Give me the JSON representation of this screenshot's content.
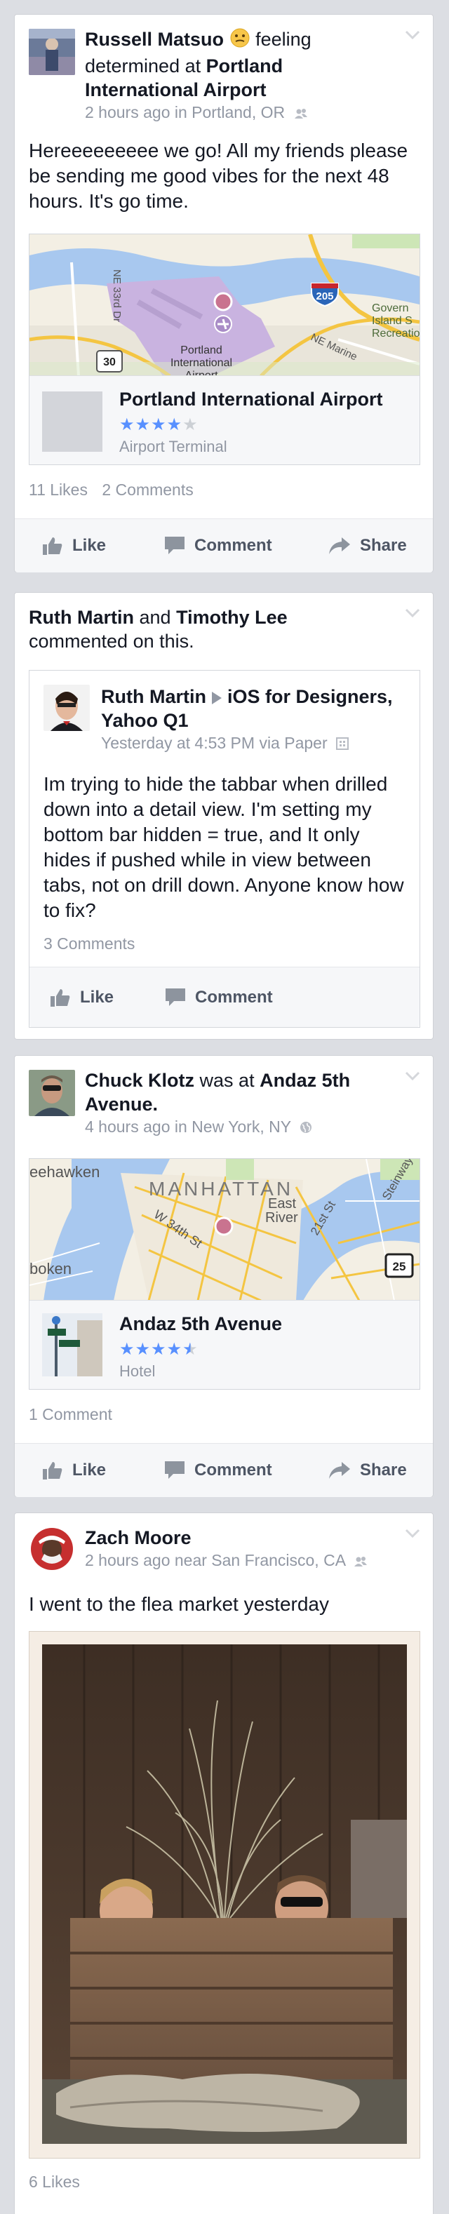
{
  "posts": [
    {
      "author": "Russell Matsuo",
      "verb": "feeling determined at",
      "location": "Portland International Airport",
      "time": "2 hours ago in Portland, OR",
      "text": "Hereeeeeeeee we go! All my friends please be sending me good vibes for the next 48 hours. It's go time.",
      "map_labels": {
        "highway1": "205",
        "highway2": "30",
        "dr": "NE 33rd Dr",
        "marine": "NE Marine",
        "govt": "Govern Island S Recreatio",
        "airport": "Portland International Airport"
      },
      "place": {
        "name": "Portland International Airport",
        "category": "Airport Terminal",
        "stars": 4
      },
      "likes": "11 Likes",
      "comments": "2 Comments",
      "actions": {
        "like": "Like",
        "comment": "Comment",
        "share": "Share"
      }
    },
    {
      "actor1": "Ruth Martin",
      "and": "and",
      "actor2": "Timothy Lee",
      "commented": "commented on this.",
      "inner_author": "Ruth Martin",
      "inner_group": "iOS for Designers, Yahoo Q1",
      "inner_time": "Yesterday at 4:53 PM via Paper",
      "text": "Im trying to hide the tabbar when drilled down into a detail view. I'm setting my bottom bar hidden = true, and It only hides if pushed while in view between tabs, not on drill down.  Anyone know how to fix?",
      "comments": "3 Comments",
      "actions": {
        "like": "Like",
        "comment": "Comment"
      }
    },
    {
      "author": "Chuck Klotz",
      "verb": "was at",
      "location": "Andaz 5th Avenue.",
      "time": "4 hours ago in New York, NY",
      "map_labels": {
        "weehawken": "eehawken",
        "manhattan": "MANHATTAN",
        "east_river": "East River",
        "w34": "W 34th St",
        "st21": "21st St",
        "steinway": "Steinway",
        "hoboken": "boken",
        "hw": "25"
      },
      "place": {
        "name": "Andaz 5th Avenue",
        "category": "Hotel",
        "stars": 4.5
      },
      "comments": "1 Comment",
      "actions": {
        "like": "Like",
        "comment": "Comment",
        "share": "Share"
      }
    },
    {
      "author": "Zach Moore",
      "time": "2 hours ago near San Francisco, CA",
      "text": "I went to the flea market yesterday",
      "likes": "6 Likes"
    }
  ],
  "colors": {
    "link": "#5890ff",
    "bg": "#dcdee3",
    "meta": "#9197a3"
  }
}
